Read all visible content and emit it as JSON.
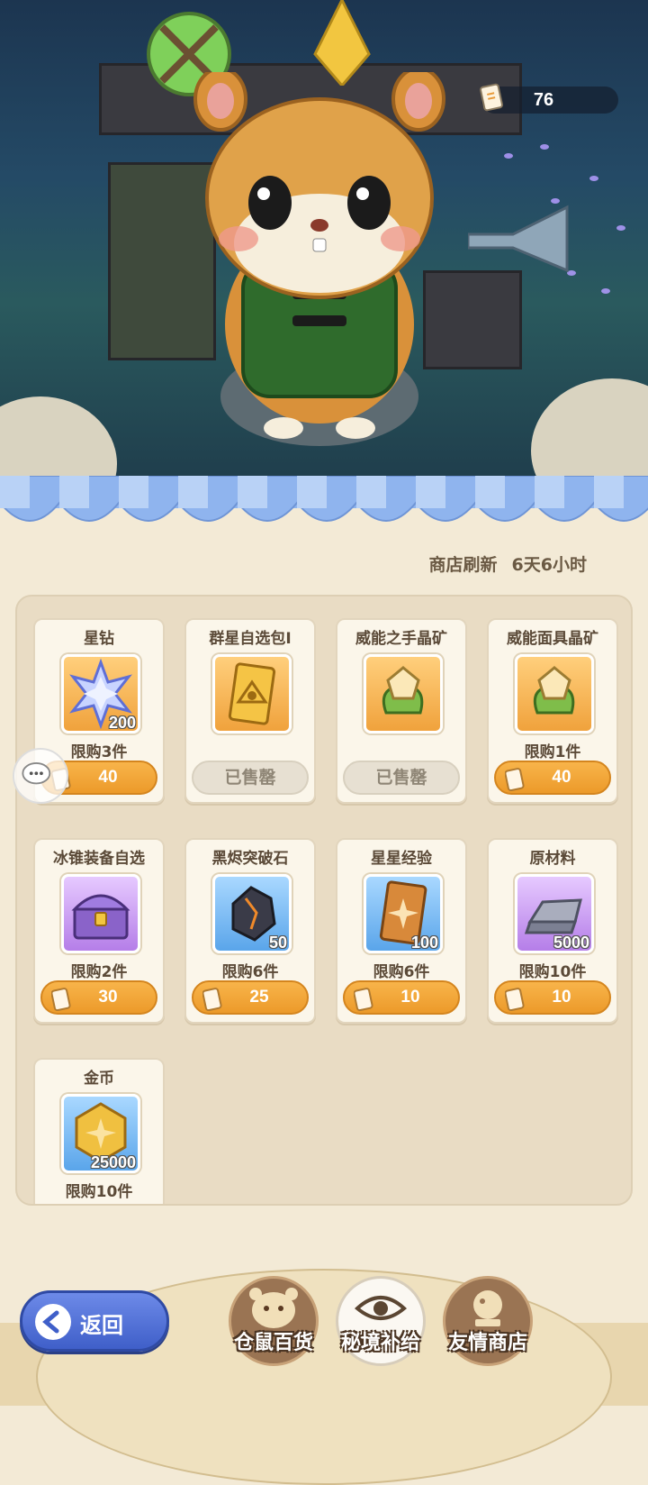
{
  "currency": {
    "tickets": "76",
    "icon": "shop-ticket-icon"
  },
  "shop": {
    "refresh_label": "商店刷新",
    "refresh_time": "6天6小时"
  },
  "items": [
    {
      "name": "星钻",
      "icon": "star-diamond-icon",
      "bg": "orange",
      "qty": "200",
      "limit": "限购3件",
      "price": "40",
      "sold_out": false
    },
    {
      "name": "群星自选包Ⅰ",
      "icon": "eye-card-icon",
      "bg": "orange",
      "qty": "",
      "limit": "",
      "price": "",
      "sold_out": true,
      "sold_label": "已售罄"
    },
    {
      "name": "威能之手晶矿",
      "icon": "crystal-ore-icon",
      "bg": "orange",
      "qty": "",
      "limit": "",
      "price": "",
      "sold_out": true,
      "sold_label": "已售罄"
    },
    {
      "name": "威能面具晶矿",
      "icon": "crystal-ore-icon",
      "bg": "orange",
      "qty": "",
      "limit": "限购1件",
      "price": "40",
      "sold_out": false
    },
    {
      "name": "冰锥装备自选",
      "icon": "treasure-chest-icon",
      "bg": "purple",
      "qty": "",
      "limit": "限购2件",
      "price": "30",
      "sold_out": false
    },
    {
      "name": "黑烬突破石",
      "icon": "black-ember-stone-icon",
      "bg": "blue",
      "qty": "50",
      "limit": "限购6件",
      "price": "25",
      "sold_out": false
    },
    {
      "name": "星星经验",
      "icon": "star-card-icon",
      "bg": "blue",
      "qty": "100",
      "limit": "限购6件",
      "price": "10",
      "sold_out": false
    },
    {
      "name": "原材料",
      "icon": "metal-ingot-icon",
      "bg": "purple",
      "qty": "5000",
      "limit": "限购10件",
      "price": "10",
      "sold_out": false
    },
    {
      "name": "金币",
      "icon": "gold-coin-icon",
      "bg": "blue",
      "qty": "25000",
      "limit": "限购10件",
      "price": "",
      "sold_out": false
    }
  ],
  "nav": {
    "back_label": "返回",
    "tabs": [
      {
        "label": "仓鼠百货",
        "icon": "hamster-icon",
        "active": false
      },
      {
        "label": "秘境补给",
        "icon": "eye-emblem-icon",
        "active": true
      },
      {
        "label": "友情商店",
        "icon": "crystal-ball-icon",
        "active": false
      }
    ]
  },
  "colors": {
    "accent_orange": "#ec9a2a",
    "back_blue": "#3f5fc9",
    "panel_bg": "#e9dcc4"
  }
}
